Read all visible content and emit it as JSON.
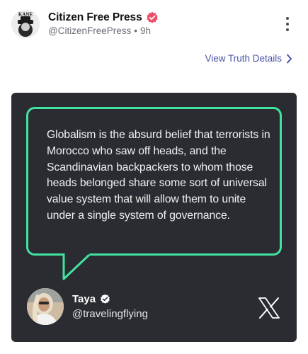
{
  "post": {
    "author_name": "Citizen Free Press",
    "handle": "@CitizenFreePress",
    "separator": "•",
    "time_ago": "9h",
    "avatar_text": "KANE"
  },
  "actions": {
    "view_details_label": "View Truth Details"
  },
  "embed": {
    "quote_text": "Globalism is the absurd belief that terrorists in Morocco who saw off heads, and the Scandinavian backpackers to whom those heads belonged share some sort of universal value system that will allow them to unite under a single system of governance.",
    "quoted_name": "Taya",
    "quoted_handle": "@travelingflying"
  },
  "colors": {
    "verified_badge": "#f04e66",
    "link": "#4b55a6",
    "card_background": "#2a2c32",
    "bubble_border": "#41e3a0"
  },
  "icons": {
    "verified": "verified-badge-icon",
    "more": "more-vertical-icon",
    "chevron": "chevron-right-icon",
    "x_logo": "x-logo-icon"
  }
}
